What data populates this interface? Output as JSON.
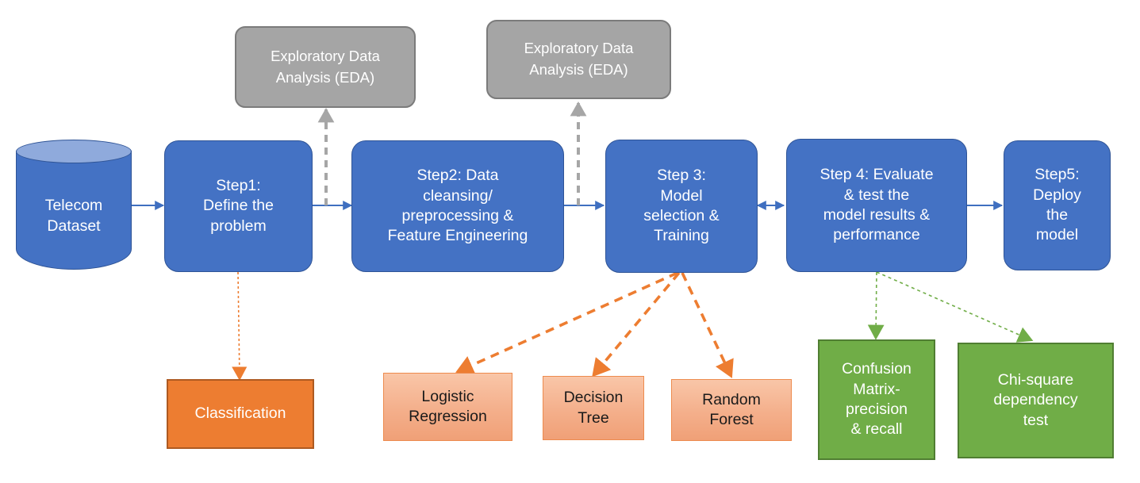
{
  "diagram": {
    "title": "Telecom churn machine-learning pipeline flowchart",
    "colors": {
      "process_blue": "#4472C4",
      "process_blue_border": "#2F5496",
      "cylinder_top": "#8FAADC",
      "eda_gray": "#A5A5A5",
      "eda_gray_border": "#7B7B7B",
      "orange_dark": "#ED7D31",
      "orange_dark_border": "#AE5A21",
      "orange_light": "#F4AF8B",
      "orange_light_border": "#ED8B4E",
      "green": "#70AD47",
      "green_border": "#507E32",
      "arrow_blue": "#3F6FC0",
      "arrow_gray": "#A6A6A6",
      "arrow_orange": "#ED7D31",
      "arrow_green": "#70AD47"
    }
  },
  "nodes": {
    "datasource": {
      "label": "Telecom\nDataset",
      "shape": "cylinder"
    },
    "eda_left": {
      "label": "Exploratory Data\nAnalysis (EDA)"
    },
    "eda_right": {
      "label": "Exploratory Data\nAnalysis (EDA)"
    },
    "step1": {
      "label": "Step1:\nDefine the\nproblem"
    },
    "step2": {
      "label": "Step2: Data\ncleansing/\npreprocessing &\nFeature Engineering"
    },
    "step3": {
      "label": "Step 3:\nModel\nselection &\nTraining"
    },
    "step4": {
      "label": "Step 4: Evaluate\n& test the\nmodel results &\nperformance"
    },
    "step5": {
      "label": "Step5:\nDeploy\nthe\nmodel"
    },
    "classification": {
      "label": "Classification"
    },
    "logistic_regression": {
      "label": "Logistic\nRegression"
    },
    "decision_tree": {
      "label": "Decision\nTree"
    },
    "random_forest": {
      "label": "Random\nForest"
    },
    "confusion_matrix": {
      "label": "Confusion\nMatrix-\nprecision\n& recall"
    },
    "chi_square": {
      "label": "Chi-square\ndependency\ntest"
    }
  },
  "edges": [
    {
      "name": "dataset-to-step1",
      "from": "datasource",
      "to": "step1",
      "style": "solid",
      "color": "#3F6FC0",
      "direction": "forward"
    },
    {
      "name": "step1-to-step2",
      "from": "step1",
      "to": "step2",
      "style": "solid",
      "color": "#3F6FC0",
      "direction": "forward"
    },
    {
      "name": "step2-to-step3",
      "from": "step2",
      "to": "step3",
      "style": "solid",
      "color": "#3F6FC0",
      "direction": "forward"
    },
    {
      "name": "step3-to-step4",
      "from": "step3",
      "to": "step4",
      "style": "solid",
      "color": "#3F6FC0",
      "direction": "both"
    },
    {
      "name": "step4-to-step5",
      "from": "step4",
      "to": "step5",
      "style": "solid",
      "color": "#3F6FC0",
      "direction": "forward"
    },
    {
      "name": "step1-link-to-eda-left",
      "from": "step1-step2-link",
      "to": "eda_left",
      "style": "dashed",
      "color": "#A6A6A6",
      "direction": "forward"
    },
    {
      "name": "step2-link-to-eda-right",
      "from": "step2-step3-link",
      "to": "eda_right",
      "style": "dashed",
      "color": "#A6A6A6",
      "direction": "forward"
    },
    {
      "name": "step1-to-classification",
      "from": "step1",
      "to": "classification",
      "style": "dotted",
      "color": "#ED7D31",
      "direction": "forward"
    },
    {
      "name": "step3-to-logistic-regression",
      "from": "step3",
      "to": "logistic_regression",
      "style": "dashed",
      "color": "#ED7D31",
      "direction": "forward"
    },
    {
      "name": "step3-to-decision-tree",
      "from": "step3",
      "to": "decision_tree",
      "style": "dashed",
      "color": "#ED7D31",
      "direction": "forward"
    },
    {
      "name": "step3-to-random-forest",
      "from": "step3",
      "to": "random_forest",
      "style": "dashed",
      "color": "#ED7D31",
      "direction": "forward"
    },
    {
      "name": "step4-to-confusion-matrix",
      "from": "step4",
      "to": "confusion_matrix",
      "style": "dashed",
      "color": "#70AD47",
      "direction": "forward"
    },
    {
      "name": "step4-to-chi-square",
      "from": "step4",
      "to": "chi_square",
      "style": "dashed",
      "color": "#70AD47",
      "direction": "forward"
    }
  ]
}
